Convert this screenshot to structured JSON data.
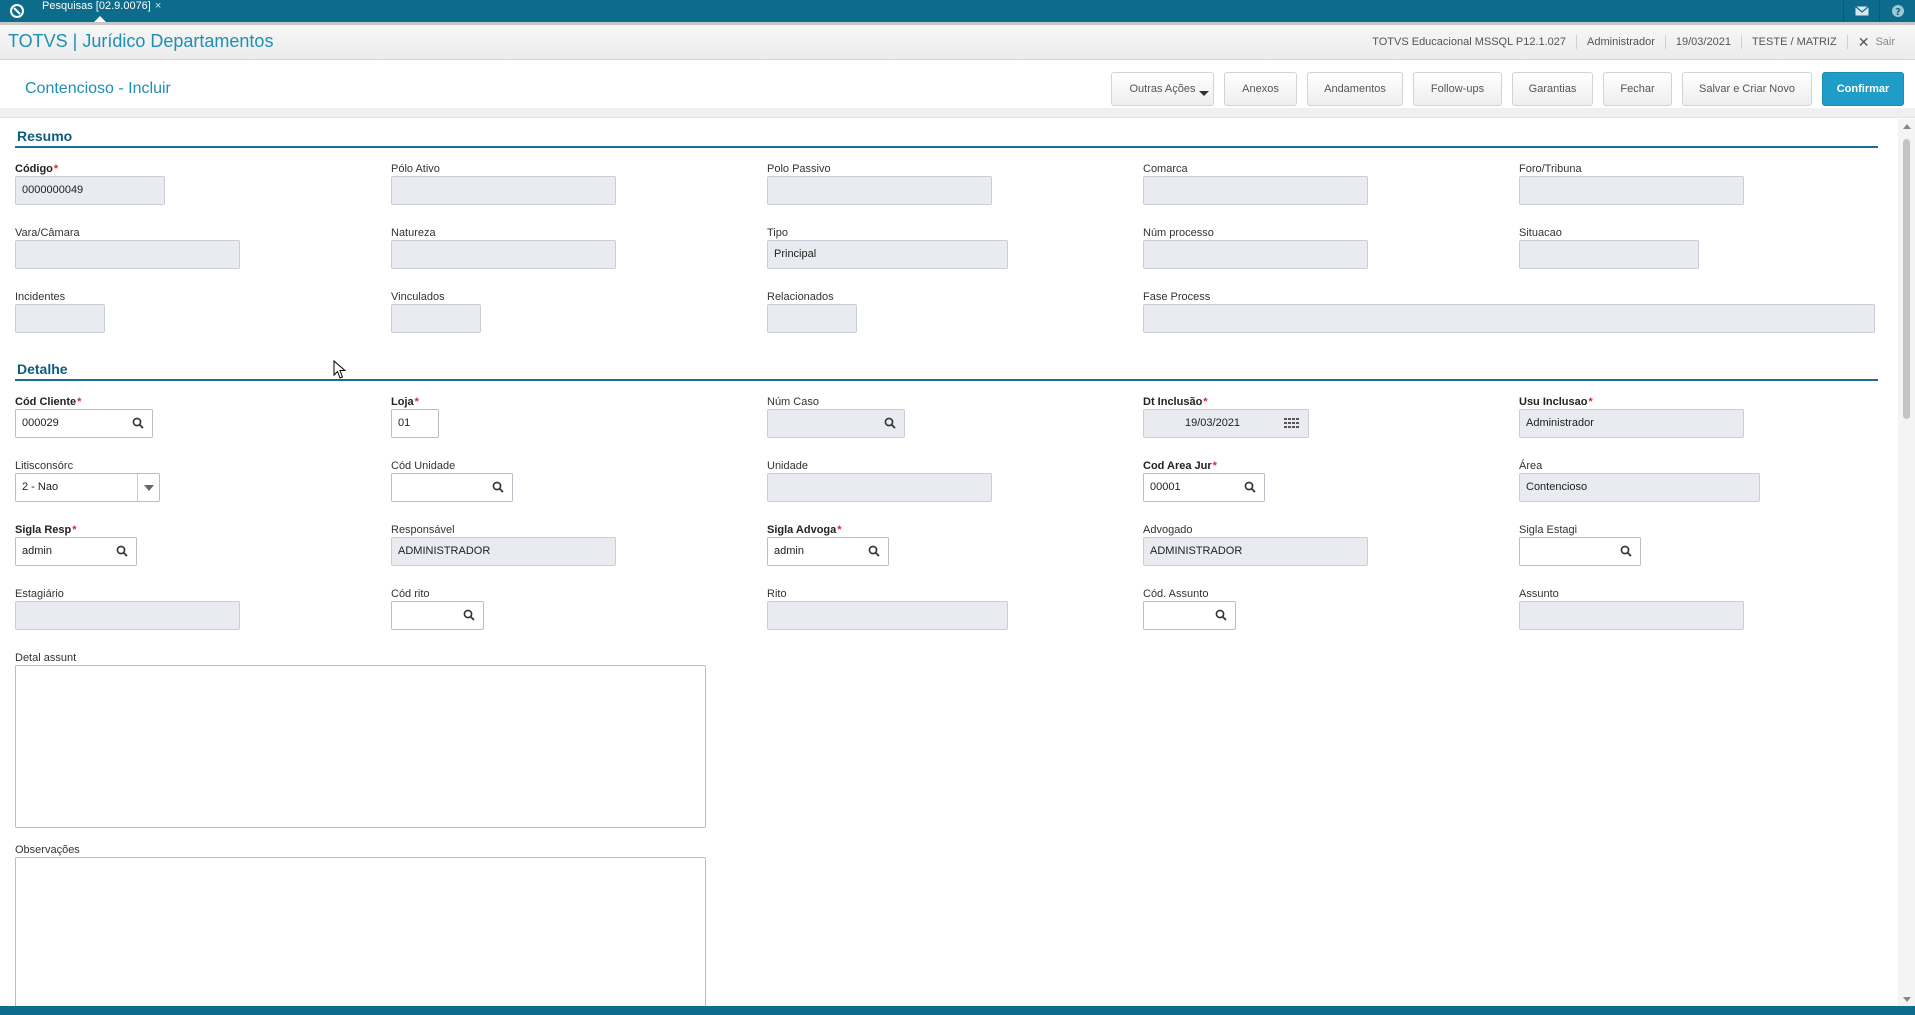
{
  "topbar": {
    "tab_label": "Pesquisas [02.9.0076]",
    "tab_close": "×"
  },
  "header": {
    "app_title": "TOTVS | Jurídico Departamentos",
    "environment": "TOTVS Educacional MSSQL P12.1.027",
    "user": "Administrador",
    "date": "19/03/2021",
    "branch": "TESTE / MATRIZ",
    "exit_label": "Sair"
  },
  "page": {
    "title": "Contencioso - Incluir",
    "buttons": {
      "outras_acoes": "Outras Ações",
      "anexos": "Anexos",
      "andamentos": "Andamentos",
      "followups": "Follow-ups",
      "garantias": "Garantias",
      "fechar": "Fechar",
      "salvar_novo": "Salvar e Criar Novo",
      "confirmar": "Confirmar"
    }
  },
  "resumo": {
    "title": "Resumo",
    "codigo": {
      "label": "Código",
      "value": "0000000049"
    },
    "polo_ativo": {
      "label": "Pólo Ativo",
      "value": ""
    },
    "polo_passivo": {
      "label": "Polo Passivo",
      "value": ""
    },
    "comarca": {
      "label": "Comarca",
      "value": ""
    },
    "foro_tribuna": {
      "label": "Foro/Tribuna",
      "value": ""
    },
    "vara_camara": {
      "label": "Vara/Câmara",
      "value": ""
    },
    "natureza": {
      "label": "Natureza",
      "value": ""
    },
    "tipo": {
      "label": "Tipo",
      "value": "Principal"
    },
    "num_processo": {
      "label": "Núm processo",
      "value": ""
    },
    "situacao": {
      "label": "Situacao",
      "value": ""
    },
    "incidentes": {
      "label": "Incidentes",
      "value": ""
    },
    "vinculados": {
      "label": "Vinculados",
      "value": ""
    },
    "relacionados": {
      "label": "Relacionados",
      "value": ""
    },
    "fase_process": {
      "label": "Fase Process",
      "value": ""
    }
  },
  "detalhe": {
    "title": "Detalhe",
    "cod_cliente": {
      "label": "Cód Cliente",
      "value": "000029"
    },
    "loja": {
      "label": "Loja",
      "value": "01"
    },
    "num_caso": {
      "label": "Núm Caso",
      "value": ""
    },
    "dt_inclusao": {
      "label": "Dt Inclusão",
      "value": "19/03/2021"
    },
    "usu_inclusao": {
      "label": "Usu Inclusao",
      "value": "Administrador"
    },
    "litisconsorc": {
      "label": "Litisconsórc",
      "value": "2 - Nao"
    },
    "cod_unidade": {
      "label": "Cód Unidade",
      "value": ""
    },
    "unidade": {
      "label": "Unidade",
      "value": ""
    },
    "cod_area_jur": {
      "label": "Cod Area Jur",
      "value": "00001"
    },
    "area": {
      "label": "Área",
      "value": "Contencioso"
    },
    "sigla_resp": {
      "label": "Sigla Resp",
      "value": "admin"
    },
    "responsavel": {
      "label": "Responsável",
      "value": "ADMINISTRADOR"
    },
    "sigla_advoga": {
      "label": "Sigla Advoga",
      "value": "admin"
    },
    "advogado": {
      "label": "Advogado",
      "value": "ADMINISTRADOR"
    },
    "sigla_estagi": {
      "label": "Sigla Estagi",
      "value": ""
    },
    "estagiario": {
      "label": "Estagiário",
      "value": ""
    },
    "cod_rito": {
      "label": "Cód rito",
      "value": ""
    },
    "rito": {
      "label": "Rito",
      "value": ""
    },
    "cod_assunto": {
      "label": "Cód. Assunto",
      "value": ""
    },
    "assunto": {
      "label": "Assunto",
      "value": ""
    },
    "detal_assunt": {
      "label": "Detal assunt",
      "value": ""
    },
    "observacoes": {
      "label": "Observações",
      "value": ""
    }
  },
  "required_mark": "*",
  "colors": {
    "brand": "#0d6c8c",
    "accent": "#1e8fb5",
    "primary_button": "#1f9cc7",
    "required": "#e0262e"
  }
}
